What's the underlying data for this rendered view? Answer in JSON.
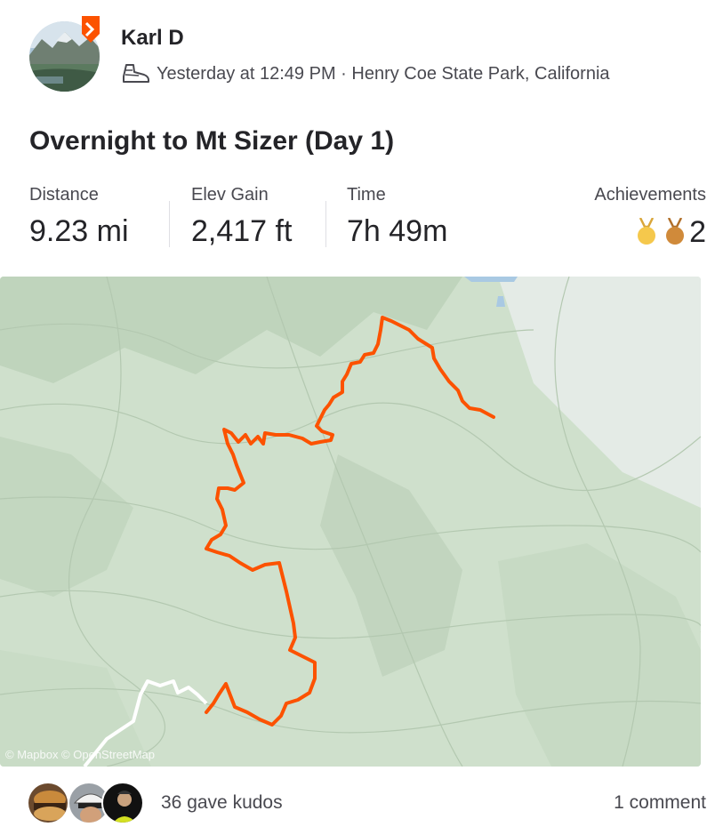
{
  "athlete": {
    "name": "Karl D",
    "avatar_icon": "landscape-avatar",
    "badge_icon": "subscriber-badge-icon",
    "badge_color": "#fc5200"
  },
  "activity": {
    "sport_icon": "hiking-shoe-icon",
    "meta": "Yesterday at 12:49 PM · Henry Coe State Park, California",
    "title": "Overnight to Mt Sizer (Day 1)"
  },
  "stats": {
    "distance": {
      "label": "Distance",
      "value": "9.23 mi"
    },
    "elev_gain": {
      "label": "Elev Gain",
      "value": "2,417 ft"
    },
    "time": {
      "label": "Time",
      "value": "7h 49m"
    },
    "achievements": {
      "label": "Achievements",
      "count": "2",
      "medals": [
        {
          "icon": "gold-medal-icon",
          "color": "#f5c84c"
        },
        {
          "icon": "bronze-medal-icon",
          "color": "#d08a3a"
        }
      ]
    }
  },
  "map": {
    "attribution": "© Mapbox © OpenStreetMap",
    "route_color": "#fc5200",
    "terrain_color": "#cfe0cc"
  },
  "social": {
    "kudos_text": "36 gave kudos",
    "comments_text": "1 comment"
  }
}
